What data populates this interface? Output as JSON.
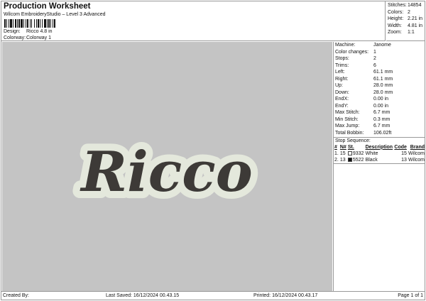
{
  "header": {
    "title": "Production Worksheet",
    "subtitle": "Wilcom EmbroideryStudio – Level 3 Advanced",
    "design_label": "Design:",
    "design_value": "Ricco 4.8 in",
    "colorway_label": "Colorway:",
    "colorway_value": "Colorway 1"
  },
  "stats": [
    {
      "k": "Stitches:",
      "v": "14854"
    },
    {
      "k": "Colors:",
      "v": "2"
    },
    {
      "k": "Height:",
      "v": "2.21 in"
    },
    {
      "k": "Width:",
      "v": "4.81 in"
    },
    {
      "k": "Zoom:",
      "v": "1:1"
    }
  ],
  "design": {
    "text": "Ricco",
    "fill": "#3d3a37",
    "outline": "#e4e8dc"
  },
  "details": [
    {
      "k": "Machine:",
      "v": "Janome"
    },
    {
      "k": "Color changes:",
      "v": "1"
    },
    {
      "k": "Stops:",
      "v": "2"
    },
    {
      "k": "Trims:",
      "v": "6"
    },
    {
      "k": "Left:",
      "v": "61.1 mm"
    },
    {
      "k": "Right:",
      "v": "61.1 mm"
    },
    {
      "k": "Up:",
      "v": "28.0 mm"
    },
    {
      "k": "Down:",
      "v": "28.0 mm"
    },
    {
      "k": "EndX:",
      "v": "0.00 in"
    },
    {
      "k": "EndY:",
      "v": "0.00 in"
    },
    {
      "k": "Max Stitch:",
      "v": "6.7 mm"
    },
    {
      "k": "Min Stitch:",
      "v": "0.3 mm"
    },
    {
      "k": "Max Jump:",
      "v": "6.7 mm"
    },
    {
      "k": "Total Bobbin:",
      "v": "106.02ft"
    }
  ],
  "stop_sequence": {
    "title": "Stop Sequence:",
    "headers": [
      "#",
      "N#",
      "St.",
      "Description",
      "Code",
      "Brand"
    ],
    "rows": [
      {
        "n": "1.",
        "num": "15",
        "color": "#ffffff",
        "st": "9332",
        "desc": "White",
        "code": "15",
        "brand": "Wilcom"
      },
      {
        "n": "2.",
        "num": "13",
        "color": "#111111",
        "st": "5522",
        "desc": "Black",
        "code": "13",
        "brand": "Wilcom"
      }
    ]
  },
  "footer": {
    "created": "Created By:",
    "saved": "Last Saved: 16/12/2024 00.43.15",
    "printed": "Printed: 16/12/2024 00.43.17",
    "page": "Page 1 of 1"
  }
}
